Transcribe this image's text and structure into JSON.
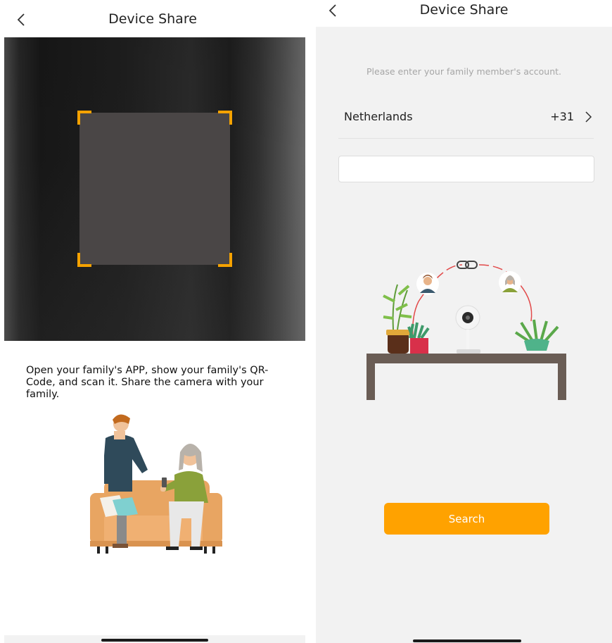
{
  "left_screen": {
    "header": {
      "title": "Device Share",
      "back_icon": "chevron-left-icon"
    },
    "scanner": {
      "frame_color": "#f5a200"
    },
    "instructions": "Open your family's APP, show your family's QR-Code, and scan it. Share the camera with your family."
  },
  "right_screen": {
    "header": {
      "title": "Device Share",
      "back_icon": "chevron-left-icon"
    },
    "hint": "Please enter your family member's account.",
    "country": {
      "name": "Netherlands",
      "code": "+31",
      "icon": "chevron-right-icon"
    },
    "account_input": {
      "value": "",
      "placeholder": ""
    },
    "search_button": "Search",
    "accent_color": "#ffa200"
  }
}
